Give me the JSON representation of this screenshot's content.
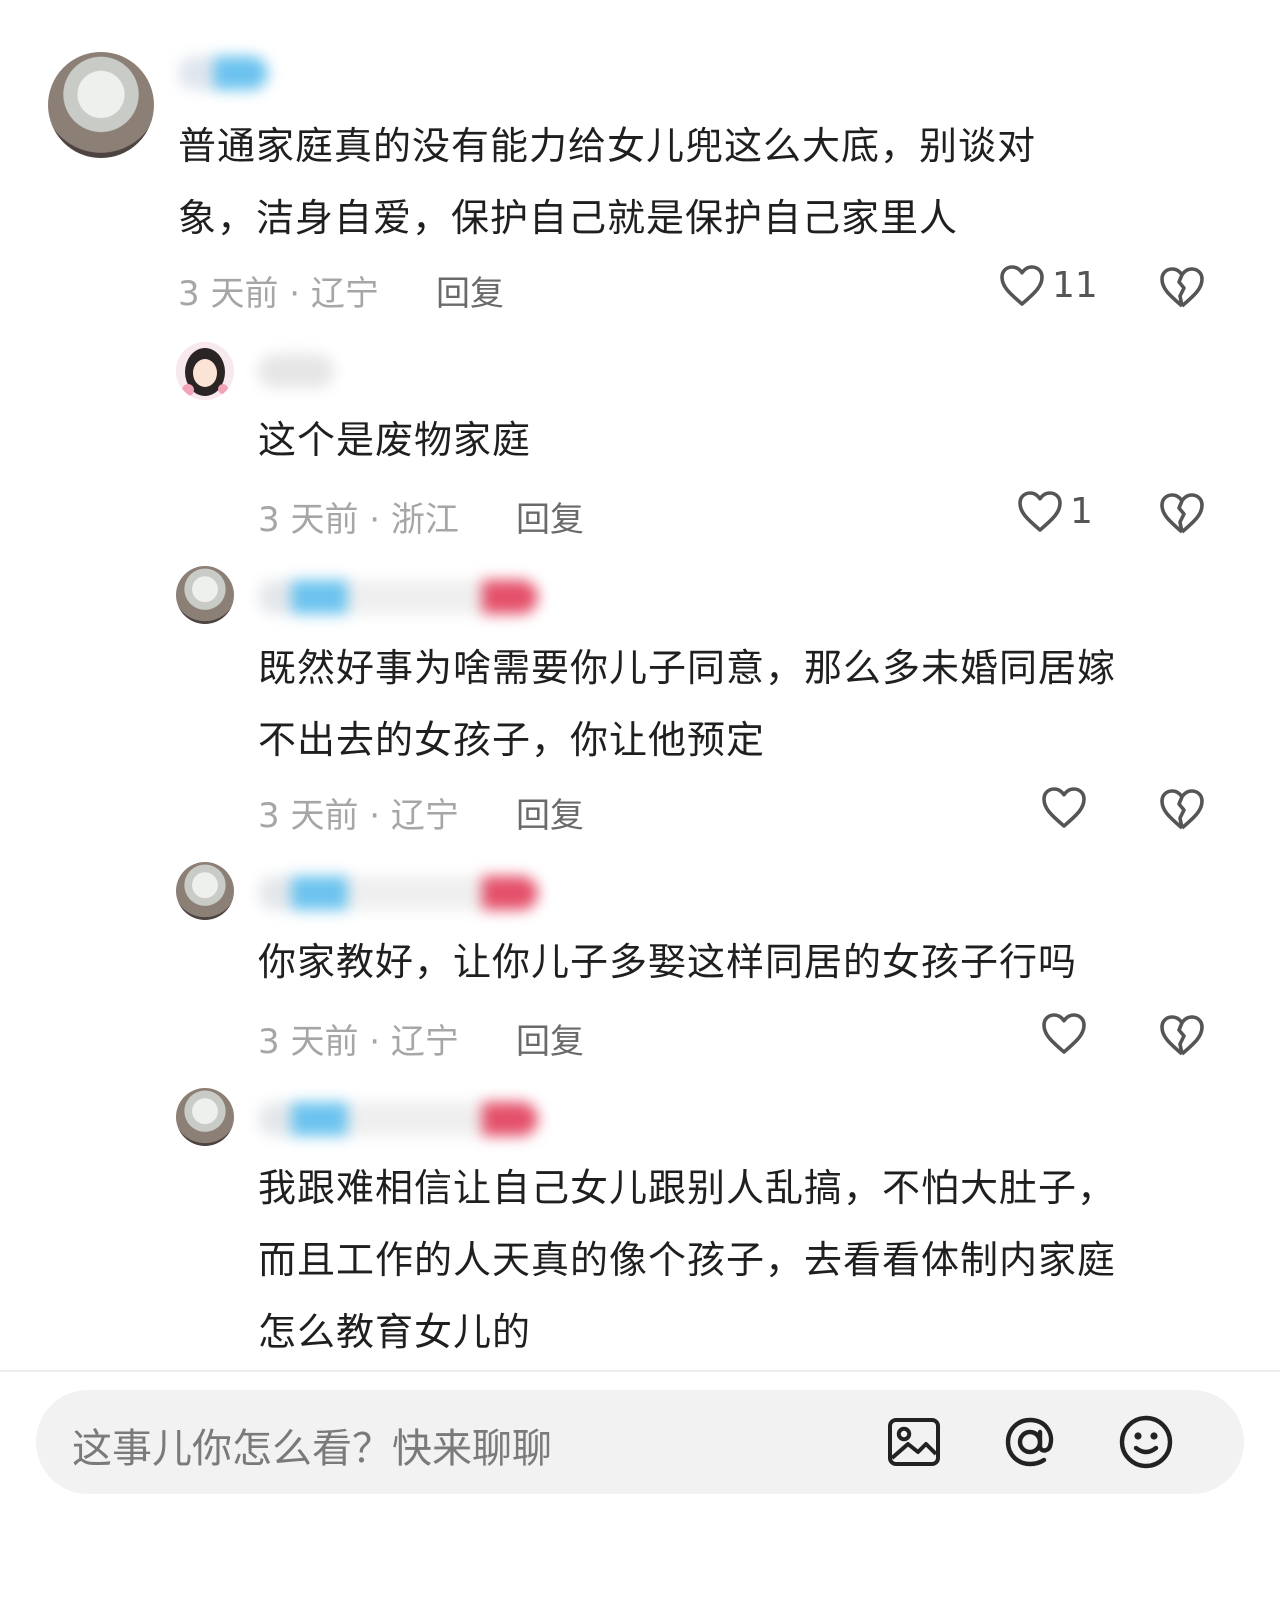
{
  "comments": [
    {
      "text_lines": [
        "普通家庭真的没有能力给女儿兜这么大底，别谈对",
        "象，洁身自爱，保护自己就是保护自己家里人"
      ],
      "meta": "3 天前 · 辽宁",
      "reply_label": "回复",
      "likes": "11"
    },
    {
      "text_lines": [
        "这个是废物家庭"
      ],
      "meta": "3 天前 · 浙江",
      "reply_label": "回复",
      "likes": "1"
    },
    {
      "text_lines": [
        "既然好事为啥需要你儿子同意，那么多未婚同居嫁",
        "不出去的女孩子，你让他预定"
      ],
      "meta": "3 天前 · 辽宁",
      "reply_label": "回复",
      "likes": ""
    },
    {
      "text_lines": [
        "你家教好，让你儿子多娶这样同居的女孩子行吗"
      ],
      "meta": "3 天前 · 辽宁",
      "reply_label": "回复",
      "likes": ""
    },
    {
      "text_lines": [
        "我跟难相信让自己女儿跟别人乱搞，不怕大肚子，",
        "而且工作的人天真的像个孩子，去看看体制内家庭",
        "怎么教育女儿的"
      ]
    }
  ],
  "input": {
    "placeholder": "这事儿你怎么看？快来聊聊",
    "icons": [
      "image-icon",
      "at-icon",
      "emoji-icon"
    ]
  },
  "icons": {
    "like": "heart-outline-icon",
    "dislike": "broken-heart-icon"
  }
}
